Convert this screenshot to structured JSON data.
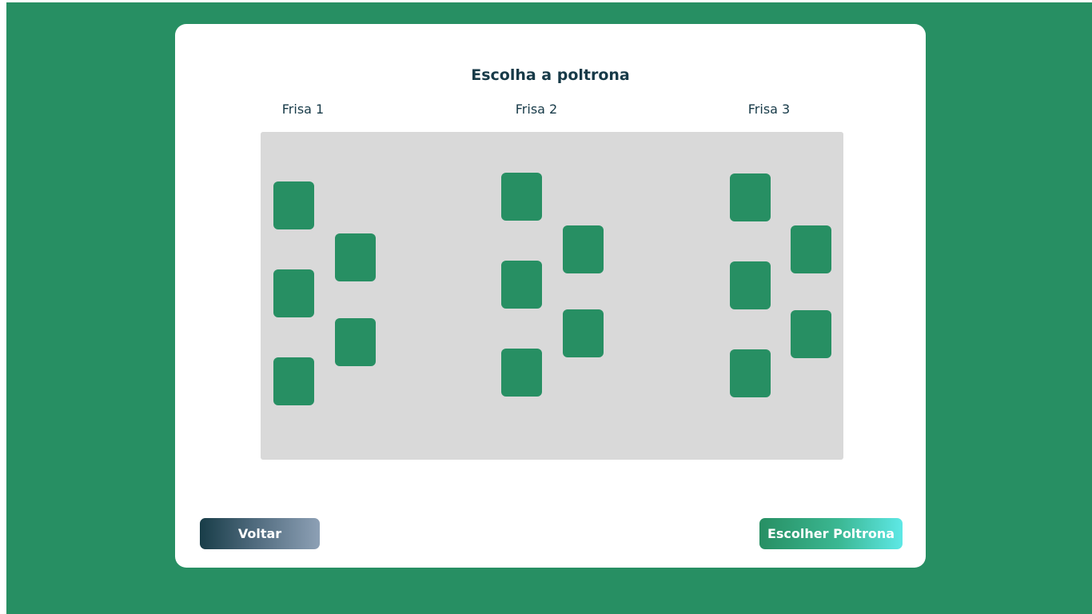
{
  "page": {
    "title": "Escolha a poltrona",
    "background_color": "#278f63",
    "accent_color": "#278f63",
    "text_color": "#173a48"
  },
  "frisas": [
    {
      "label": "Frisa 1",
      "seats": 5
    },
    {
      "label": "Frisa 2",
      "seats": 5
    },
    {
      "label": "Frisa 3",
      "seats": 5
    }
  ],
  "actions": {
    "back_label": "Voltar",
    "choose_label": "Escolher Poltrona"
  }
}
